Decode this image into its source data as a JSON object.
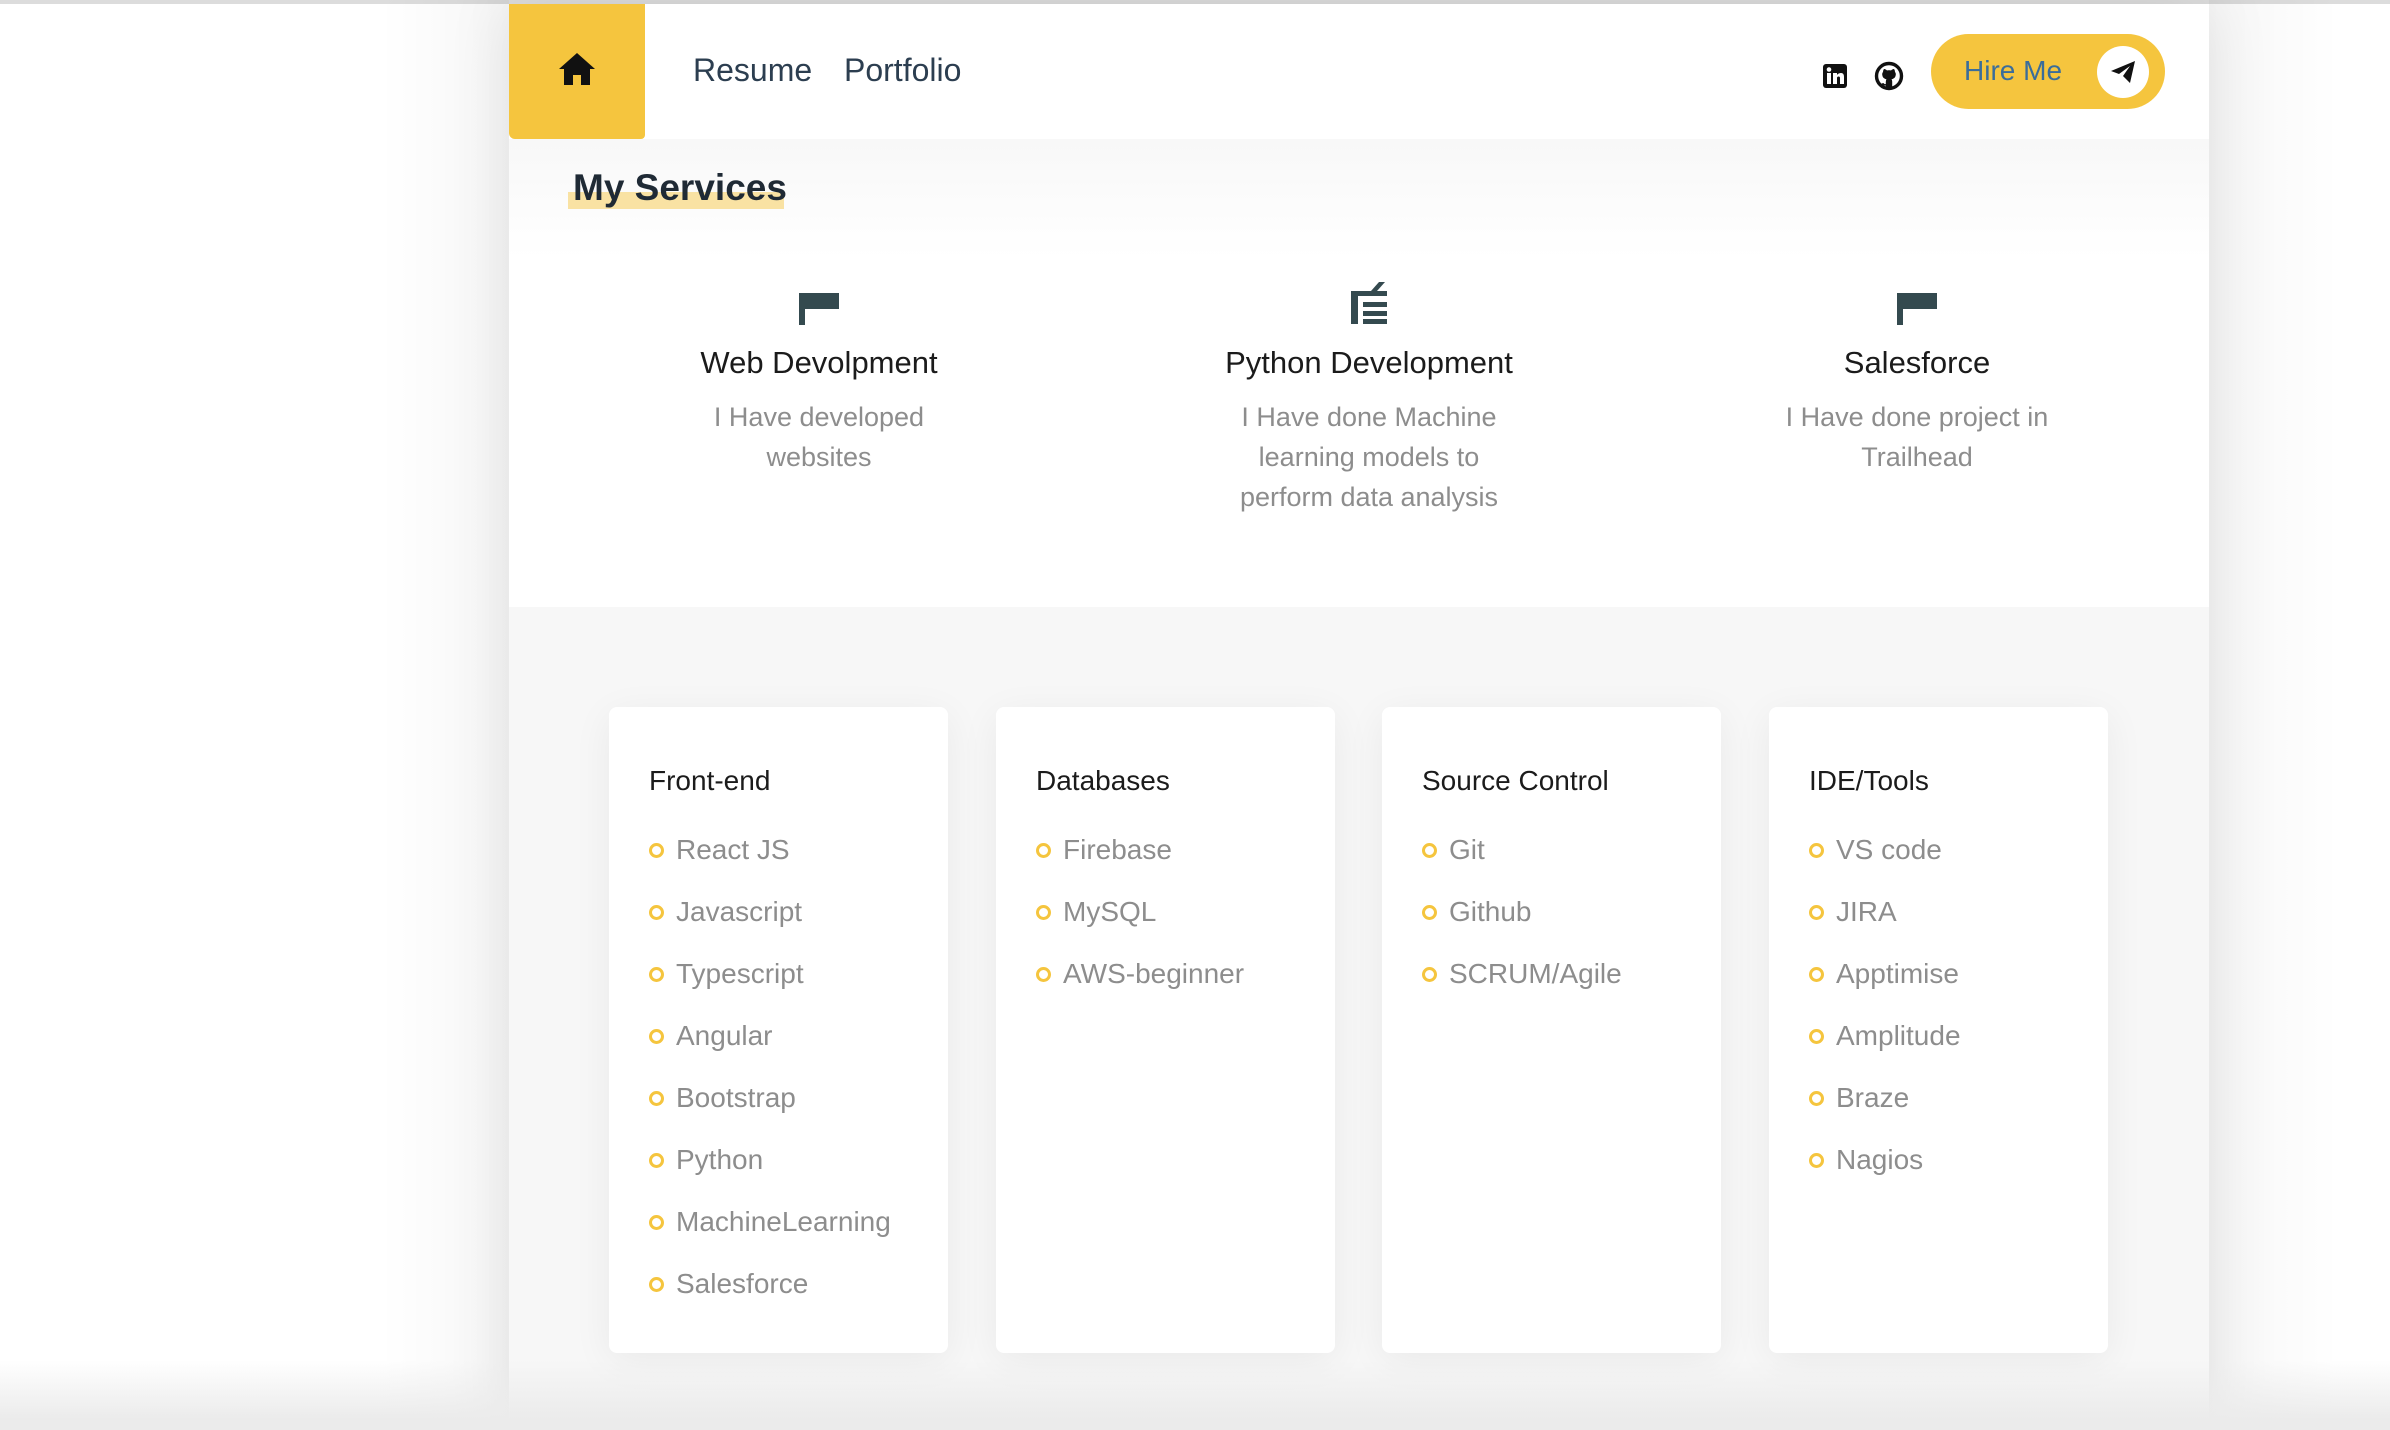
{
  "header": {
    "nav": [
      {
        "label": "Resume"
      },
      {
        "label": "Portfolio"
      }
    ],
    "hire_label": "Hire Me",
    "icons": [
      "home-icon",
      "linkedin-icon",
      "github-icon",
      "send-icon"
    ]
  },
  "services": {
    "title": "My Services",
    "items": [
      {
        "title": "Web Devolpment",
        "desc": "I Have developed websites",
        "icon": "flag-icon"
      },
      {
        "title": "Python Development",
        "desc": "I Have done Machine learning models to perform data analysis",
        "icon": "comb-icon"
      },
      {
        "title": "Salesforce",
        "desc": "I Have done project in Trailhead",
        "icon": "flag-icon"
      }
    ]
  },
  "skills": [
    {
      "title": "Front-end",
      "items": [
        "React JS",
        "Javascript",
        "Typescript",
        "Angular",
        "Bootstrap",
        "Python",
        "MachineLearning",
        "Salesforce"
      ]
    },
    {
      "title": "Databases",
      "items": [
        "Firebase",
        "MySQL",
        "AWS-beginner"
      ]
    },
    {
      "title": "Source Control",
      "items": [
        "Git",
        "Github",
        "SCRUM/Agile"
      ]
    },
    {
      "title": "IDE/Tools",
      "items": [
        "VS code",
        "JIRA",
        "Apptimise",
        "Amplitude",
        "Braze",
        "Nagios"
      ]
    }
  ],
  "colors": {
    "accent": "#f5c53e",
    "dark": "#2c3e50",
    "muted": "#8d8d8d",
    "link": "#3a6d9a"
  }
}
